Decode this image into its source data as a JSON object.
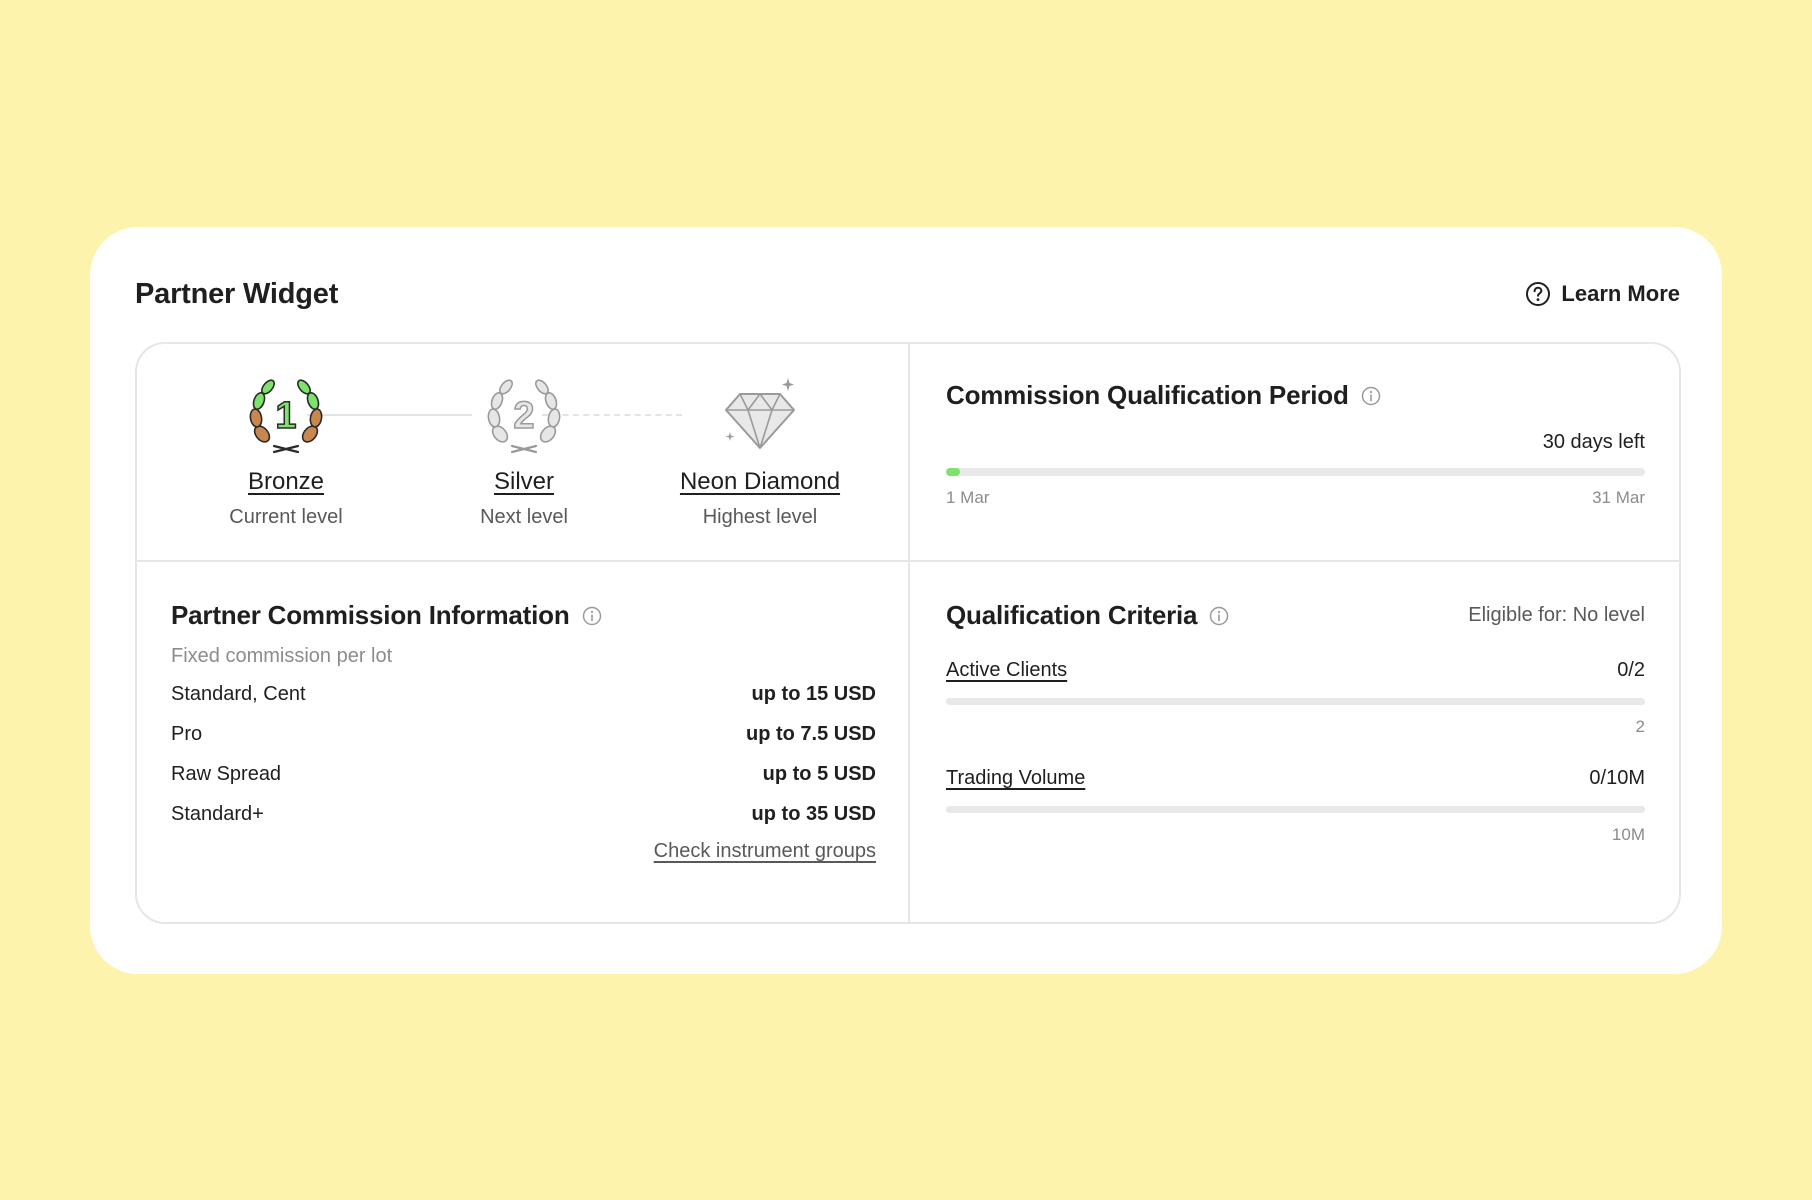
{
  "widget": {
    "title": "Partner Widget",
    "learn_more": "Learn More"
  },
  "levels": [
    {
      "name": "Bronze",
      "status": "Current level",
      "icon": "laurel-1-icon"
    },
    {
      "name": "Silver",
      "status": "Next level",
      "icon": "laurel-2-icon"
    },
    {
      "name": "Neon Diamond",
      "status": "Highest level",
      "icon": "diamond-icon"
    }
  ],
  "period": {
    "title": "Commission Qualification Period",
    "days_left": "30 days left",
    "start_label": "1 Mar",
    "end_label": "31 Mar",
    "progress": 0.02
  },
  "commission": {
    "title": "Partner Commission Information",
    "subtitle": "Fixed commission per lot",
    "rows": [
      {
        "label": "Standard, Cent",
        "value": "up to 15 USD"
      },
      {
        "label": "Pro",
        "value": "up to 7.5 USD"
      },
      {
        "label": "Raw Spread",
        "value": "up to 5 USD"
      },
      {
        "label": "Standard+",
        "value": "up to 35 USD"
      }
    ],
    "link": "Check instrument groups"
  },
  "criteria": {
    "title": "Qualification Criteria",
    "eligible": "Eligible for: No level",
    "items": [
      {
        "label": "Active Clients",
        "value": "0/2",
        "target": "2",
        "progress": 0
      },
      {
        "label": "Trading Volume",
        "value": "0/10M",
        "target": "10M",
        "progress": 0
      }
    ]
  },
  "colors": {
    "background": "#FEF3AC",
    "accent_green": "#7ee36b",
    "bronze": "#c8874f",
    "silver": "#a8a8a8"
  }
}
